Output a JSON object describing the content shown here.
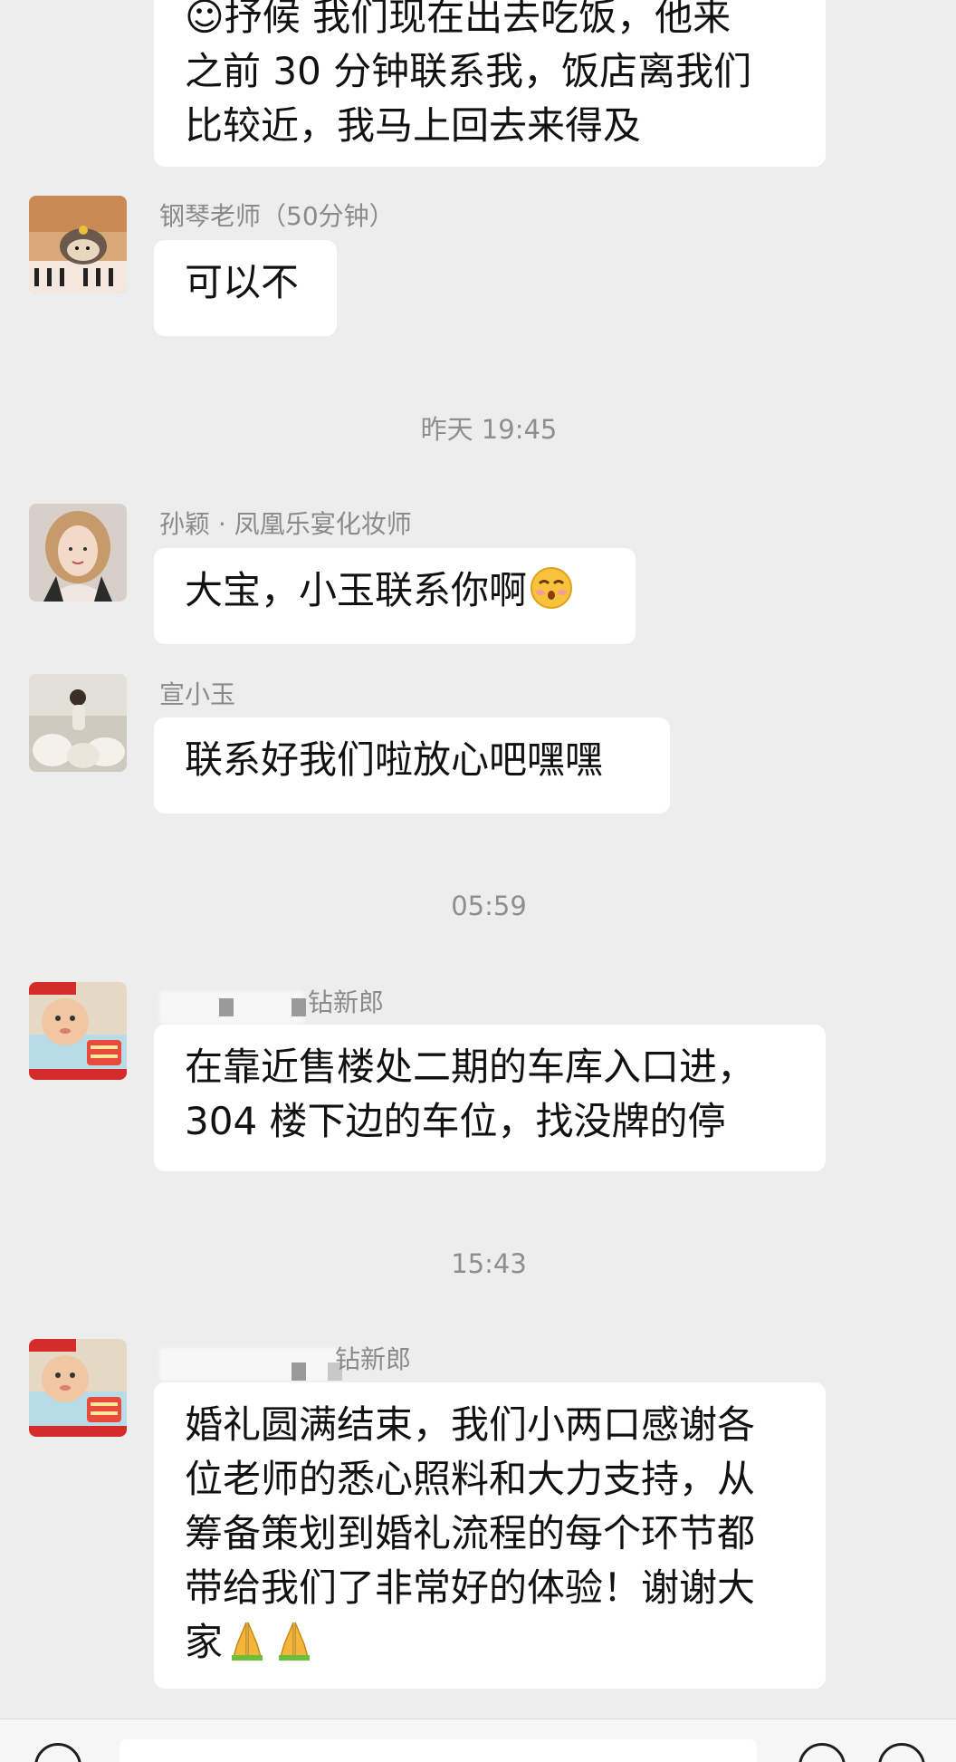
{
  "messages": [
    {
      "lines": [
        "☺抒候 我们现在出去吃饭，他来",
        "之前 30 分钟联系我，饭店离我们",
        "比较近，我马上回去来得及"
      ]
    },
    {
      "sender": "钢琴老师（50分钟）",
      "lines": [
        "可以不"
      ]
    },
    {
      "sender": "孙颖 · 凤凰乐宴化妆师",
      "lines": [
        "大宝，小玉联系你啊"
      ],
      "emoji": "kissing-face-emoji"
    },
    {
      "sender": "宣小玉",
      "lines": [
        "联系好我们啦放心吧嘿嘿"
      ]
    },
    {
      "sender": "钻新郎",
      "lines": [
        "在靠近售楼处二期的车库入口进，",
        "304 楼下边的车位，找没牌的停"
      ]
    },
    {
      "sender": "钻新郎",
      "lines": [
        "婚礼圆满结束，我们小两口感谢各",
        "位老师的悉心照料和大力支持，从",
        "筹备策划到婚礼流程的每个环节都",
        "带给我们了非常好的体验！谢谢大",
        "家"
      ],
      "emoji": "folded-hands-emoji"
    }
  ],
  "timestamps": [
    "昨天 19:45",
    "05:59",
    "15:43"
  ],
  "colors": {
    "background": "#ededed",
    "bubble": "#ffffff",
    "sender_text": "#8a8a8a",
    "timestamp_text": "#8e8e8e",
    "message_text": "#111111"
  }
}
